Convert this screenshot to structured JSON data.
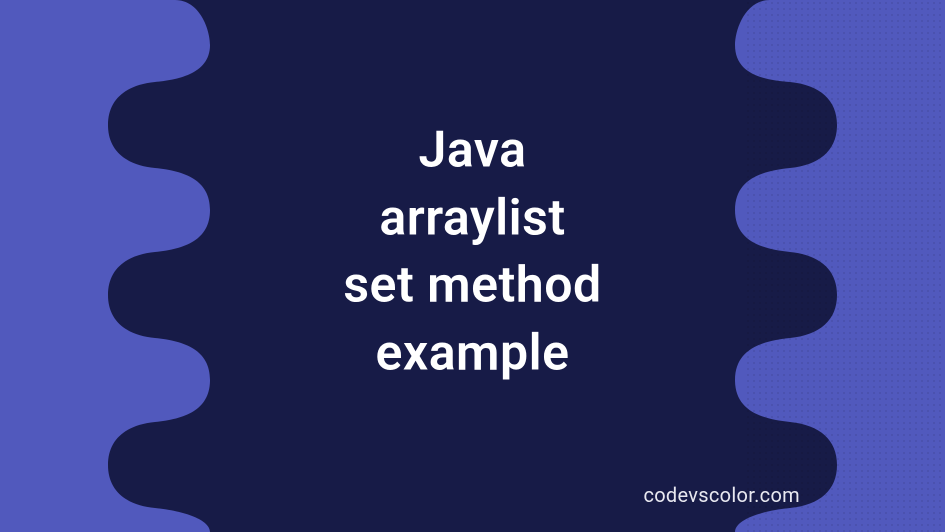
{
  "content": {
    "title_line1": "Java",
    "title_line2": "arraylist",
    "title_line3": "set method",
    "title_line4": "example",
    "watermark": "codevscolor.com"
  },
  "colors": {
    "background_purple": "#5159bd",
    "dark_navy": "#171b47",
    "text_white": "#ffffff",
    "watermark_light": "#e8e8f0"
  }
}
